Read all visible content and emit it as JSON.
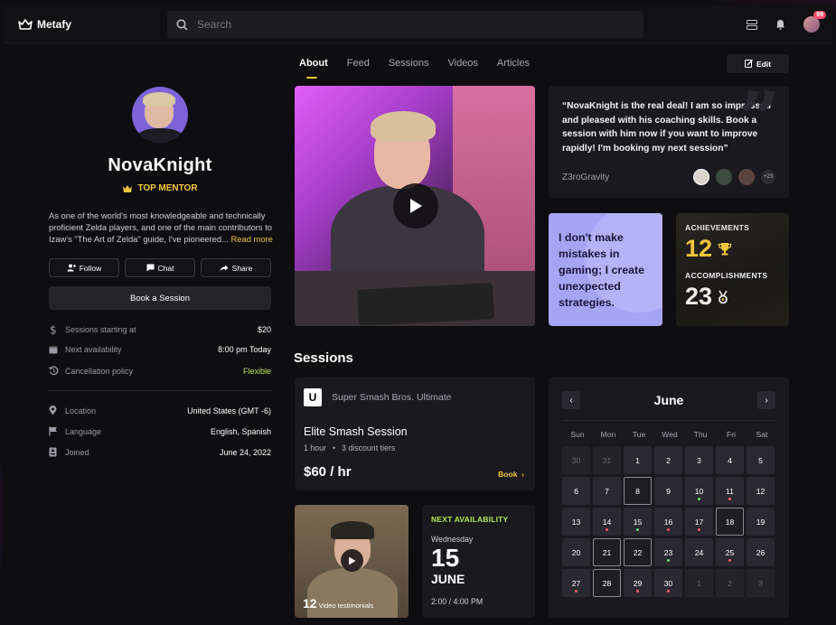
{
  "app": {
    "name": "Metafy"
  },
  "search": {
    "placeholder": "Search"
  },
  "notifications": {
    "badge": "99"
  },
  "tabs": [
    "About",
    "Feed",
    "Sessions",
    "Videos",
    "Articles"
  ],
  "edit_label": "Edit",
  "profile": {
    "name": "NovaKnight",
    "badge": "TOP MENTOR",
    "bio": "As one of the world's most knowledgeable and technically proficient Zelda players, and one of the main contributors to Izaw's \"The Art of Zelda\" guide, I've pioneered...",
    "read_more": "Read more",
    "buttons": {
      "follow": "Follow",
      "chat": "Chat",
      "share": "Share"
    },
    "book": "Book a Session",
    "info": [
      {
        "icon": "dollar-icon",
        "label": "Sessions starting at",
        "value": "$20"
      },
      {
        "icon": "calendar-icon",
        "label": "Next availability",
        "value": "8:00 pm Today"
      },
      {
        "icon": "history-icon",
        "label": "Cancellation policy",
        "value": "Flexible"
      }
    ],
    "details": [
      {
        "icon": "location-pin-icon",
        "label": "Location",
        "value": "United States (GMT -6)"
      },
      {
        "icon": "flag-icon",
        "label": "Language",
        "value": "English, Spanish"
      },
      {
        "icon": "id-card-icon",
        "label": "Joined",
        "value": "June 24, 2022"
      }
    ]
  },
  "quote": {
    "text": "“NovaKnight is the real deal! I am so impressed and pleased with his coaching skills. Book a session with him now if you want to improve rapidly! I'm booking my next session”",
    "author": "Z3roGravity",
    "more": "+23"
  },
  "statement": "I don't make mistakes in gaming; I create unexpected strategies.",
  "stats": {
    "achievements_label": "ACHIEVEMENTS",
    "achievements": "12",
    "accomplishments_label": "ACCOMPLISHMENTS",
    "accomplishments": "23"
  },
  "sessions": {
    "heading": "Sessions",
    "game": "Super Smash Bros. Ultimate",
    "game_logo": "U",
    "title": "Elite Smash Session",
    "duration": "1 hour",
    "tiers": "3 discount tiers",
    "price": "$60 / hr",
    "book": "Book"
  },
  "testimonials": {
    "count": "12",
    "label": "Video testimonials"
  },
  "next_availability": {
    "label": "NEXT AVAILABILITY",
    "weekday": "Wednesday",
    "day": "15",
    "month": "JUNE",
    "time": "2:00 / 4:00 PM"
  },
  "calendar": {
    "month": "June",
    "weekdays": [
      "Sun",
      "Mon",
      "Tue",
      "Wed",
      "Thu",
      "Fri",
      "Sat"
    ],
    "days": [
      {
        "d": "30",
        "muted": true
      },
      {
        "d": "31",
        "muted": true
      },
      {
        "d": "1"
      },
      {
        "d": "2"
      },
      {
        "d": "3"
      },
      {
        "d": "4"
      },
      {
        "d": "5"
      },
      {
        "d": "6"
      },
      {
        "d": "7"
      },
      {
        "d": "8",
        "selected": true
      },
      {
        "d": "9"
      },
      {
        "d": "10",
        "dot": "green"
      },
      {
        "d": "11",
        "dot": "red"
      },
      {
        "d": "12"
      },
      {
        "d": "13"
      },
      {
        "d": "14",
        "dot": "red"
      },
      {
        "d": "15",
        "dot": "green"
      },
      {
        "d": "16",
        "dot": "red"
      },
      {
        "d": "17",
        "dot": "red"
      },
      {
        "d": "18",
        "selected": true
      },
      {
        "d": "19"
      },
      {
        "d": "20"
      },
      {
        "d": "21",
        "selected": true
      },
      {
        "d": "22",
        "selected": true
      },
      {
        "d": "23",
        "dot": "green"
      },
      {
        "d": "24"
      },
      {
        "d": "25",
        "dot": "red"
      },
      {
        "d": "26"
      },
      {
        "d": "27",
        "dot": "red"
      },
      {
        "d": "28",
        "selected": true
      },
      {
        "d": "29",
        "dot": "red"
      },
      {
        "d": "30",
        "dot": "red"
      },
      {
        "d": "1",
        "muted": true
      },
      {
        "d": "2",
        "muted": true
      },
      {
        "d": "3",
        "muted": true
      }
    ]
  },
  "colors": {
    "accent": "#f5c53c",
    "green": "#b5e853",
    "statement_bg": "#a6a4f5"
  }
}
